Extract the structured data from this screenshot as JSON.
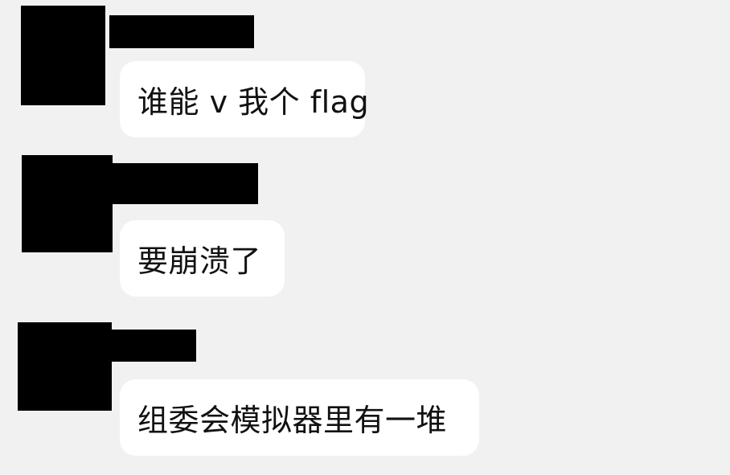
{
  "chat": {
    "messages": [
      {
        "text": "谁能 v 我个 flag"
      },
      {
        "text": "要崩溃了"
      },
      {
        "text": "组委会模拟器里有一堆"
      }
    ]
  },
  "colors": {
    "background": "#f1f1f1",
    "bubble": "#ffffff",
    "redaction": "#000000",
    "text": "#111111"
  }
}
